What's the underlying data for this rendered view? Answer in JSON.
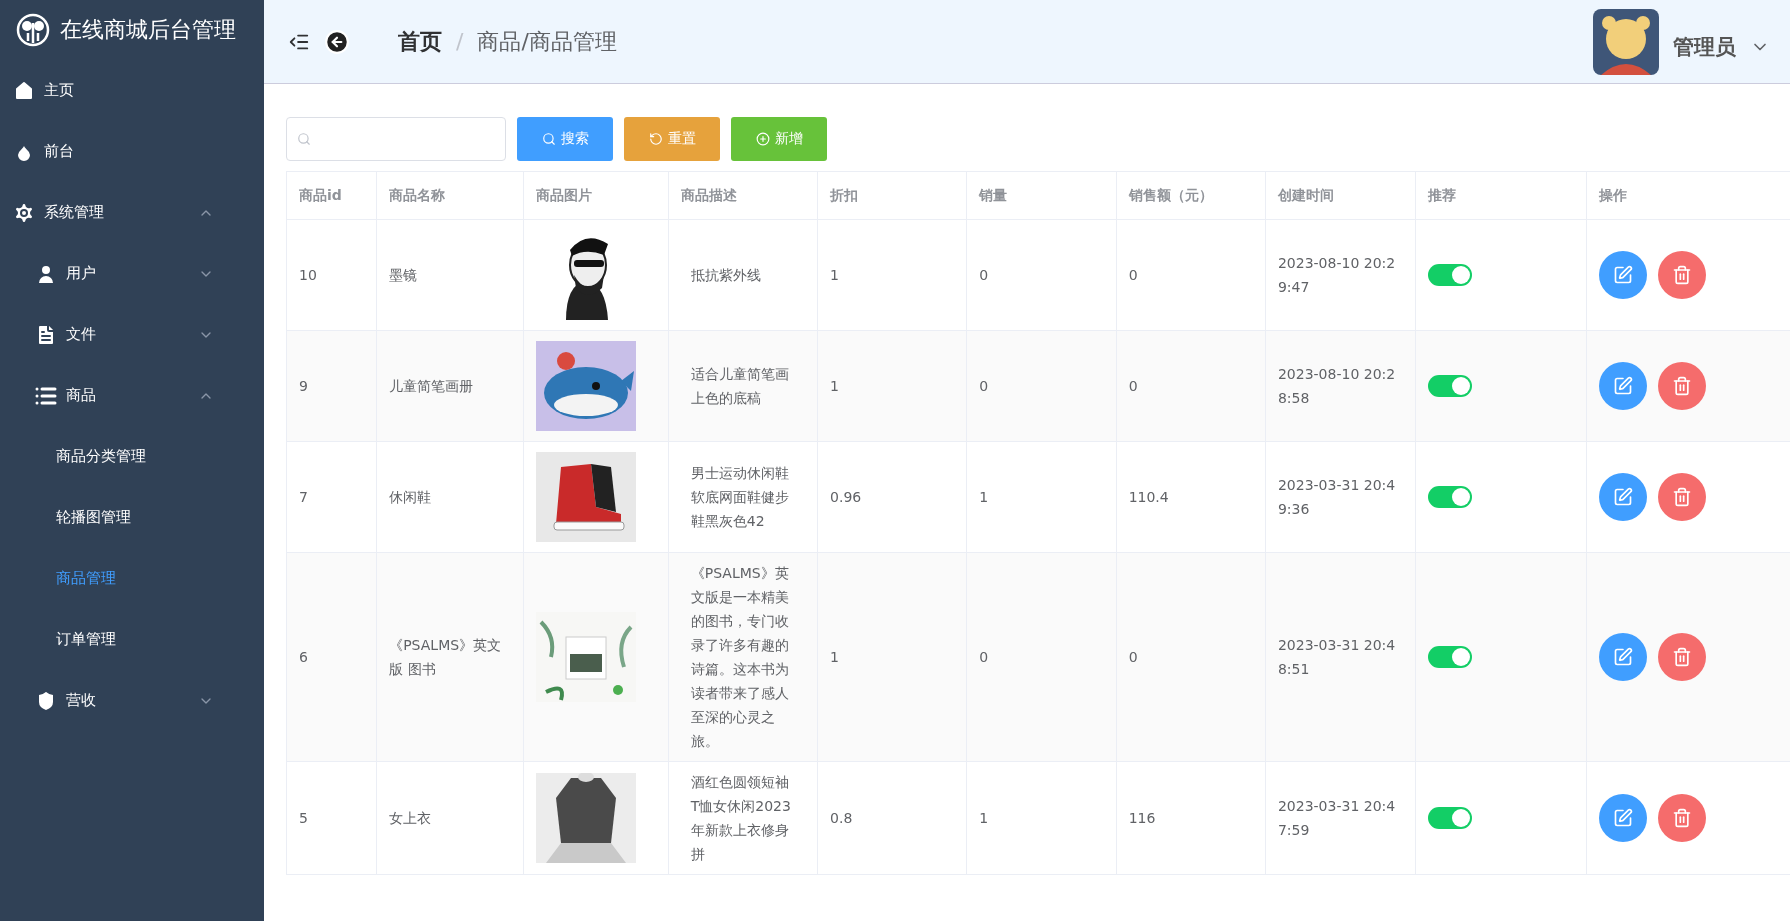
{
  "brand": {
    "title": "在线商城后台管理"
  },
  "sidebar": {
    "items": [
      {
        "label": "主页"
      },
      {
        "label": "前台"
      },
      {
        "label": "系统管理",
        "expanded": true,
        "children": [
          {
            "label": "用户",
            "expanded": false
          },
          {
            "label": "文件",
            "expanded": false
          },
          {
            "label": "商品",
            "expanded": true,
            "children": [
              {
                "label": "商品分类管理",
                "selected": false
              },
              {
                "label": "轮播图管理",
                "selected": false
              },
              {
                "label": "商品管理",
                "selected": true
              },
              {
                "label": "订单管理",
                "selected": false
              }
            ]
          },
          {
            "label": "营收",
            "expanded": false
          }
        ]
      }
    ]
  },
  "header": {
    "breadcrumb": [
      "首页",
      "/",
      "商品/商品管理"
    ],
    "user": "管理员"
  },
  "toolbar": {
    "buttons": [
      {
        "label": "搜索",
        "kind": "search"
      },
      {
        "label": "重置",
        "kind": "reset"
      },
      {
        "label": "新增",
        "kind": "add"
      }
    ]
  },
  "table": {
    "columns": [
      "商品id",
      "商品名称",
      "商品图片",
      "商品描述",
      "折扣",
      "销量",
      "销售额（元）",
      "创建时间",
      "推荐",
      "操作"
    ],
    "rows": [
      {
        "id": "10",
        "name": "墨镜",
        "description": "抵抗紫外线",
        "discount": "1",
        "sales": "0",
        "revenue": "0",
        "created": "2023-08-10  20:29:47",
        "recommended": true
      },
      {
        "id": "9",
        "name": "儿童简笔画册",
        "description": "适合儿童简笔画上色的底稿",
        "discount": "1",
        "sales": "0",
        "revenue": "0",
        "created": "2023-08-10  20:28:58",
        "recommended": true
      },
      {
        "id": "7",
        "name": "休闲鞋",
        "description": "男士运动休闲鞋软底网面鞋健步鞋黑灰色42",
        "discount": "0.96",
        "sales": "1",
        "revenue": "110.4",
        "created": "2023-03-31  20:49:36",
        "recommended": true
      },
      {
        "id": "6",
        "name": "《PSALMS》英文版 图书",
        "description": "《PSALMS》英文版是一本精美的图书，专门收录了许多有趣的诗篇。这本书为读者带来了感人至深的心灵之旅。",
        "discount": "1",
        "sales": "0",
        "revenue": "0",
        "created": "2023-03-31  20:48:51",
        "recommended": true
      },
      {
        "id": "5",
        "name": "女上衣",
        "description": "酒红色圆领短袖T恤女休闲2023年新款上衣修身拼",
        "discount": "0.8",
        "sales": "1",
        "revenue": "116",
        "created": "2023-03-31  20:47:59",
        "recommended": true
      }
    ]
  }
}
